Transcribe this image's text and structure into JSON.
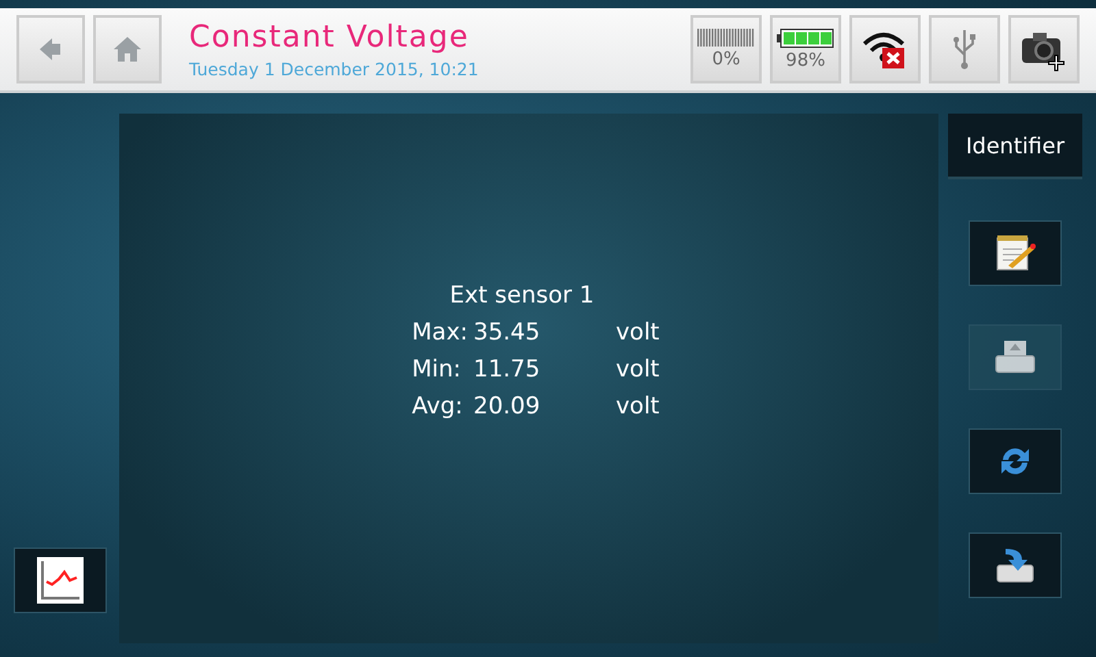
{
  "header": {
    "title": "Constant Voltage",
    "datetime": "Tuesday 1 December 2015, 10:21"
  },
  "status": {
    "storage": "0%",
    "battery": {
      "reading": "98%"
    },
    "wifi_connected": false
  },
  "panel": {
    "title": "Ext sensor 1",
    "rows": [
      {
        "label": "Max:",
        "value": "35.45",
        "unit": "volt"
      },
      {
        "label": "Min:",
        "value": "11.75",
        "unit": "volt"
      },
      {
        "label": "Avg:",
        "value": "20.09",
        "unit": "volt"
      }
    ]
  },
  "identifier_button": "Identifier",
  "side_buttons": [
    {
      "kind": "edit",
      "disabled": false
    },
    {
      "kind": "print",
      "disabled": true
    },
    {
      "kind": "refresh",
      "disabled": false
    },
    {
      "kind": "save",
      "disabled": false
    }
  ]
}
